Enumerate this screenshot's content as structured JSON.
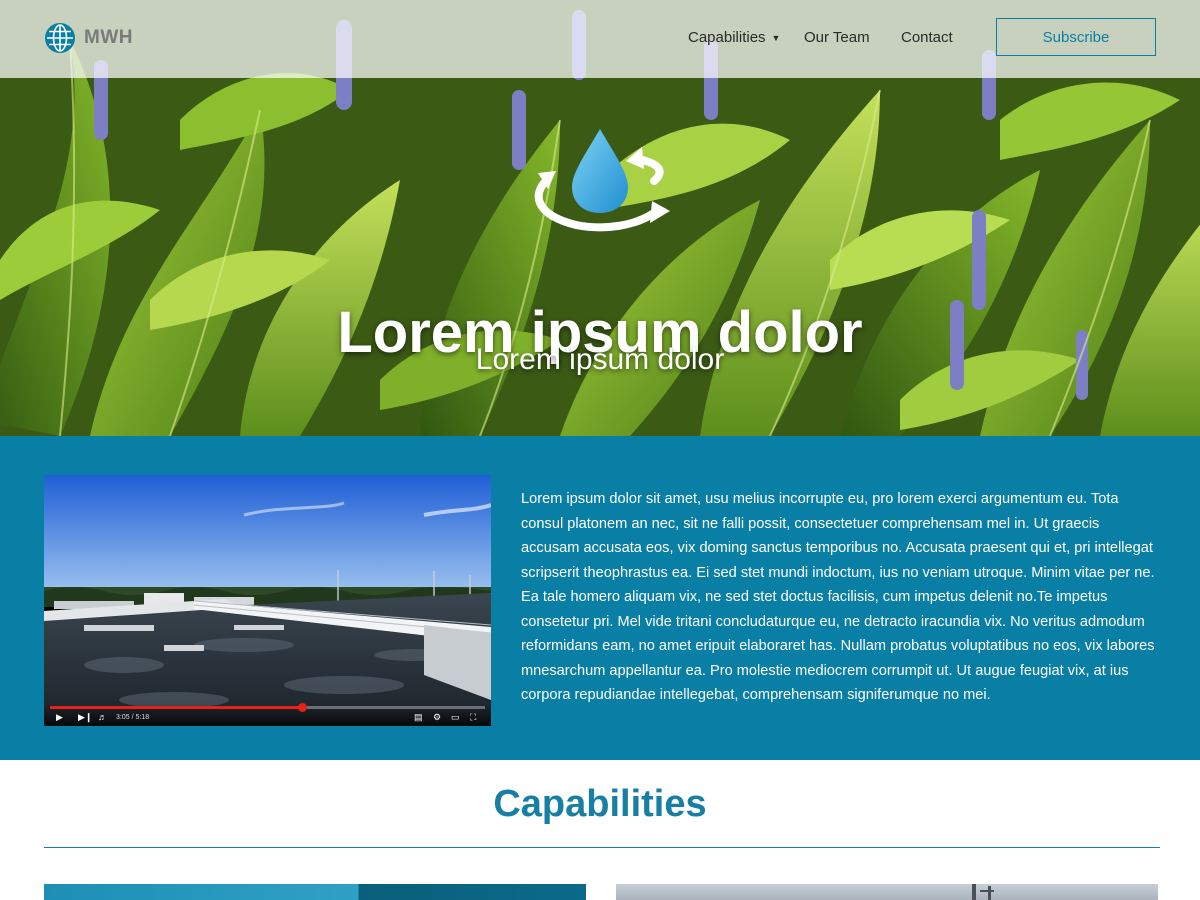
{
  "brand": {
    "logo_text": "MWH"
  },
  "nav": {
    "items": [
      {
        "label": "Capabilities",
        "has_dropdown": true
      },
      {
        "label": "Our Team"
      },
      {
        "label": "Contact"
      }
    ],
    "subscribe_label": "Subscribe"
  },
  "hero": {
    "icon": "water-drop-cycle-icon",
    "title": "Lorem ipsum dolor",
    "subtitle": "Lorem ipsum dolor"
  },
  "video": {
    "time_display": "3:05 / 5:18",
    "progress_fraction": 0.58
  },
  "about": {
    "text": "Lorem ipsum dolor sit amet, usu melius incorrupte eu, pro lorem exerci argumentum eu. Tota consul platonem an nec, sit ne falli possit, consectetuer comprehensam mel in. Ut graecis accusam accusata eos, vix doming sanctus temporibus no. Accusata praesent qui et, pri intellegat scripserit theophrastus ea. Ei sed stet mundi indoctum, ius no veniam utroque. Minim vitae per ne. Ea tale homero aliquam vix, ne sed stet doctus facilisis, cum impetus delenit no.Te impetus consetetur pri. Mel vide tritani concludaturque eu, ne detracto iracundia vix. No veritus admodum reformidans eam, no amet eripuit elaboraret has. Nullam probatus voluptatibus no eos, vix labores mnesarchum appellantur ea. Pro molestie mediocrem corrumpit ut. Ut augue feugiat vix, at ius corpora repudiandae intellegebat, comprehensam signiferumque no mei."
  },
  "capabilities": {
    "title": "Capabilities"
  },
  "colors": {
    "brand_blue": "#0a7fa6",
    "heading_blue": "#167fa3",
    "progress_red": "#e62117",
    "drop_blue": "#4ab1e3"
  }
}
